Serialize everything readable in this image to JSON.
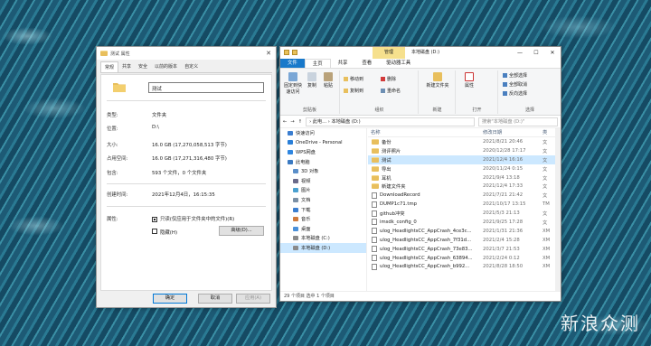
{
  "watermark": "新浪众测",
  "properties": {
    "title": "测试 属性",
    "close_glyph": "✕",
    "tabs": [
      "常规",
      "共享",
      "安全",
      "以前的版本",
      "自定义"
    ],
    "name_value": "测试",
    "rows": [
      {
        "k": "类型:",
        "v": "文件夹"
      },
      {
        "k": "位置:",
        "v": "D:\\"
      },
      {
        "k": "大小:",
        "v": "16.0 GB (17,270,058,513 字节)"
      },
      {
        "k": "占用空间:",
        "v": "16.0 GB (17,271,316,480 字节)"
      },
      {
        "k": "包含:",
        "v": "593 个文件，0 个文件夹"
      },
      {
        "k": "创建时间:",
        "v": "2021年12月4日，16:15:35"
      }
    ],
    "attributes_label": "属性:",
    "readonly_label": "只读(仅应用于文件夹中的文件)(R)",
    "hidden_label": "隐藏(H)",
    "advanced_label": "高级(D)...",
    "ok_label": "确定",
    "cancel_label": "取消",
    "apply_label": "应用(A)"
  },
  "explorer": {
    "context_tab": "管理",
    "title": "本地磁盘 (D:)",
    "win_buttons": [
      "—",
      "☐",
      "✕"
    ],
    "menus": [
      "文件",
      "主页",
      "共享",
      "查看",
      "驱动器工具"
    ],
    "ribbon": {
      "clipboard": {
        "label": "剪贴板",
        "pin": "固定到快速访问",
        "copy": "复制",
        "paste": "粘贴"
      },
      "organize": {
        "label": "组织",
        "move": "移动到",
        "copy_to": "复制到",
        "delete": "删除",
        "rename": "重命名"
      },
      "new": {
        "label": "新建",
        "new_folder": "新建文件夹"
      },
      "open": {
        "label": "打开",
        "properties": "属性"
      },
      "select": {
        "label": "选择",
        "all": "全部选择",
        "none": "全部取消",
        "invert": "反向选择"
      }
    },
    "address": "› 此电... › 本地磁盘 (D:)",
    "search_placeholder": "搜索\"本地磁盘 (D:)\"",
    "nav_items": [
      "快速访问",
      "OneDrive - Personal",
      "WPS网盘",
      "此电脑",
      "3D 对象",
      "视频",
      "图片",
      "文档",
      "下载",
      "音乐",
      "桌面",
      "本地磁盘 (C:)",
      "本地磁盘 (D:)"
    ],
    "columns": [
      "名称",
      "修改日期",
      "类"
    ],
    "files": [
      {
        "name": "备份",
        "date": "2021/8/21 20:46",
        "type": "文",
        "folder": true
      },
      {
        "name": "测评照片",
        "date": "2020/12/28 17:17",
        "type": "文",
        "folder": true
      },
      {
        "name": "测试",
        "date": "2021/12/4 16:16",
        "type": "文",
        "folder": true,
        "selected": true
      },
      {
        "name": "导出",
        "date": "2020/11/24 0:15",
        "type": "文",
        "folder": true
      },
      {
        "name": "耳机",
        "date": "2021/9/4 13:18",
        "type": "文",
        "folder": true
      },
      {
        "name": "新建文件夹",
        "date": "2021/12/4 17:33",
        "type": "文",
        "folder": true
      },
      {
        "name": "DownloadRecord",
        "date": "2021/7/21 21:42",
        "type": "文",
        "folder": false
      },
      {
        "name": "DUMP1c71.tmp",
        "date": "2021/10/17 13:15",
        "type": "TM",
        "folder": false
      },
      {
        "name": "github冲突",
        "date": "2021/5/3 21:13",
        "type": "文",
        "folder": false
      },
      {
        "name": "imsdk_config_0",
        "date": "2021/9/25 17:28",
        "type": "文",
        "folder": false
      },
      {
        "name": "ulog_HeadlightsCC_AppCrash_4ce3c...",
        "date": "2021/1/31 21:36",
        "type": "XM",
        "folder": false
      },
      {
        "name": "ulog_HeadlightsCC_AppCrash_7f31d...",
        "date": "2021/2/4 15:28",
        "type": "XM",
        "folder": false
      },
      {
        "name": "ulog_HeadlightsCC_AppCrash_73e83...",
        "date": "2021/3/7 21:53",
        "type": "XM",
        "folder": false
      },
      {
        "name": "ulog_HeadlightsCC_AppCrash_63894...",
        "date": "2021/2/24 0:12",
        "type": "XM",
        "folder": false
      },
      {
        "name": "ulog_HeadlightsCC_AppCrash_b992...",
        "date": "2021/8/28 18:50",
        "type": "XM",
        "folder": false
      }
    ],
    "status": "29 个项目    选中 1 个项目"
  }
}
